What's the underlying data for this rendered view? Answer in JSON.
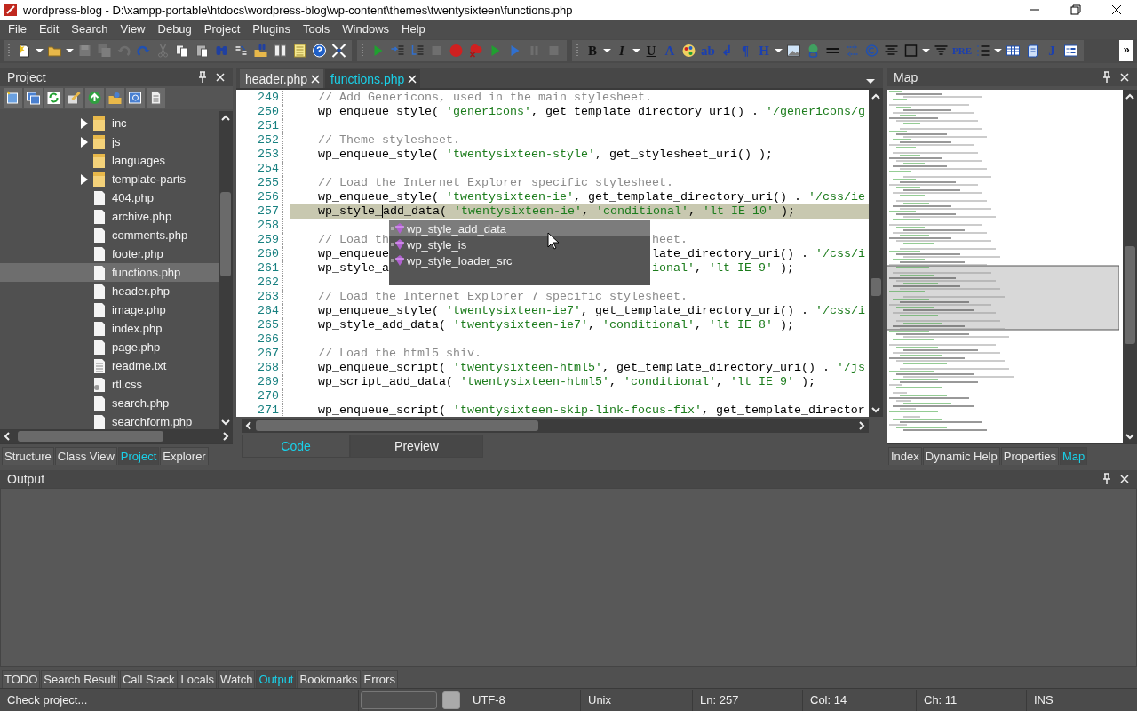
{
  "window": {
    "title": "wordpress-blog - D:\\xampp-portable\\htdocs\\wordpress-blog\\wp-content\\themes\\twentysixteen\\functions.php"
  },
  "menu": [
    "File",
    "Edit",
    "Search",
    "View",
    "Debug",
    "Project",
    "Plugins",
    "Tools",
    "Windows",
    "Help"
  ],
  "toolbars": [
    {
      "items": [
        {
          "kind": "new",
          "disabled": false
        },
        {
          "kind": "dropdown",
          "disabled": false
        },
        {
          "kind": "folder",
          "disabled": false
        },
        {
          "kind": "dropdown",
          "disabled": false
        },
        {
          "kind": "save",
          "disabled": true
        },
        {
          "kind": "saveall",
          "disabled": true
        },
        {
          "kind": "undo",
          "disabled": true
        },
        {
          "kind": "redo",
          "disabled": false
        },
        {
          "kind": "cut",
          "disabled": true
        },
        {
          "kind": "copy",
          "disabled": false
        },
        {
          "kind": "paste",
          "disabled": false
        },
        {
          "kind": "find",
          "disabled": false
        },
        {
          "kind": "replace",
          "disabled": false
        },
        {
          "kind": "findfiles",
          "disabled": false
        },
        {
          "kind": "columns",
          "disabled": false
        },
        {
          "kind": "list",
          "disabled": false
        },
        {
          "kind": "help",
          "disabled": false
        },
        {
          "kind": "fullscreen",
          "disabled": false
        }
      ]
    },
    {
      "items": [
        {
          "kind": "run",
          "disabled": false
        },
        {
          "kind": "stepinto",
          "disabled": false
        },
        {
          "kind": "stepout",
          "disabled": false
        },
        {
          "kind": "stop",
          "disabled": true
        },
        {
          "kind": "breakpoint",
          "disabled": false
        },
        {
          "kind": "clearbreak",
          "disabled": false
        },
        {
          "kind": "run",
          "disabled": false
        },
        {
          "kind": "runblue",
          "disabled": false
        },
        {
          "kind": "pause",
          "disabled": true
        },
        {
          "kind": "stop",
          "disabled": true
        }
      ]
    },
    {
      "items": [
        {
          "kind": "bold",
          "text": "B",
          "disabled": false
        },
        {
          "kind": "dropdown",
          "disabled": false
        },
        {
          "kind": "italic",
          "text": "I",
          "disabled": false
        },
        {
          "kind": "dropdown",
          "disabled": false
        },
        {
          "kind": "underline",
          "text": "U",
          "disabled": false
        },
        {
          "kind": "glyph",
          "text": "A",
          "disabled": false
        },
        {
          "kind": "palette",
          "disabled": false
        },
        {
          "kind": "glyph",
          "text": "ab",
          "disabled": false
        },
        {
          "kind": "glyph",
          "text": "↲",
          "disabled": false
        },
        {
          "kind": "glyph",
          "text": "¶",
          "disabled": false
        },
        {
          "kind": "glyph",
          "text": "H",
          "disabled": false
        },
        {
          "kind": "dropdown",
          "disabled": false
        },
        {
          "kind": "image",
          "disabled": false
        },
        {
          "kind": "globe",
          "disabled": false
        },
        {
          "kind": "hr",
          "disabled": false
        },
        {
          "kind": "arrows",
          "disabled": false
        },
        {
          "kind": "copyright",
          "disabled": false
        },
        {
          "kind": "center",
          "disabled": false
        },
        {
          "kind": "box",
          "disabled": false
        },
        {
          "kind": "dropdown",
          "disabled": false
        },
        {
          "kind": "align",
          "disabled": false
        },
        {
          "kind": "glyph",
          "text": "PRE",
          "disabled": false
        },
        {
          "kind": "numlist",
          "disabled": false
        },
        {
          "kind": "dropdown",
          "disabled": false
        },
        {
          "kind": "table",
          "disabled": false
        },
        {
          "kind": "script",
          "disabled": false
        },
        {
          "kind": "glyph",
          "text": "J",
          "disabled": false
        },
        {
          "kind": "form",
          "disabled": false
        }
      ]
    }
  ],
  "toolbar_overflow": "»",
  "project_panel": {
    "title": "Project",
    "tree": [
      {
        "name": "inc",
        "kind": "folder",
        "expandable": true,
        "selected": false
      },
      {
        "name": "js",
        "kind": "folder",
        "expandable": true,
        "selected": false
      },
      {
        "name": "languages",
        "kind": "folder",
        "expandable": false,
        "selected": false
      },
      {
        "name": "template-parts",
        "kind": "folder",
        "expandable": true,
        "selected": false
      },
      {
        "name": "404.php",
        "kind": "file",
        "expandable": false,
        "selected": false
      },
      {
        "name": "archive.php",
        "kind": "file",
        "expandable": false,
        "selected": false
      },
      {
        "name": "comments.php",
        "kind": "file",
        "expandable": false,
        "selected": false
      },
      {
        "name": "footer.php",
        "kind": "file",
        "expandable": false,
        "selected": false
      },
      {
        "name": "functions.php",
        "kind": "file",
        "expandable": false,
        "selected": true
      },
      {
        "name": "header.php",
        "kind": "file",
        "expandable": false,
        "selected": false
      },
      {
        "name": "image.php",
        "kind": "file",
        "expandable": false,
        "selected": false
      },
      {
        "name": "index.php",
        "kind": "file",
        "expandable": false,
        "selected": false
      },
      {
        "name": "page.php",
        "kind": "file",
        "expandable": false,
        "selected": false
      },
      {
        "name": "readme.txt",
        "kind": "text",
        "expandable": false,
        "selected": false
      },
      {
        "name": "rtl.css",
        "kind": "css",
        "expandable": false,
        "selected": false
      },
      {
        "name": "search.php",
        "kind": "file",
        "expandable": false,
        "selected": false
      },
      {
        "name": "searchform.php",
        "kind": "file",
        "expandable": false,
        "selected": false
      }
    ],
    "tabs": [
      {
        "label": "Structure",
        "selected": false
      },
      {
        "label": "Class View",
        "selected": false
      },
      {
        "label": "Project",
        "selected": true
      },
      {
        "label": "Explorer",
        "selected": false
      }
    ]
  },
  "editor": {
    "tabs": [
      {
        "label": "header.php",
        "selected": false
      },
      {
        "label": "functions.php",
        "selected": true
      }
    ],
    "lines": [
      {
        "number": "249",
        "current": false,
        "segments": [
          {
            "kind": "comment",
            "text": "// Add Genericons, used in the main stylesheet."
          }
        ]
      },
      {
        "number": "250",
        "current": false,
        "segments": [
          {
            "kind": "code",
            "text": "wp_enqueue_style( "
          },
          {
            "kind": "string",
            "text": "'genericons'"
          },
          {
            "kind": "code",
            "text": ", get_template_directory_uri() . "
          },
          {
            "kind": "string",
            "text": "'/genericons/g"
          }
        ]
      },
      {
        "number": "251",
        "current": false
      },
      {
        "number": "252",
        "current": false,
        "segments": [
          {
            "kind": "comment",
            "text": "// Theme stylesheet."
          }
        ]
      },
      {
        "number": "253",
        "current": false,
        "segments": [
          {
            "kind": "code",
            "text": "wp_enqueue_style( "
          },
          {
            "kind": "string",
            "text": "'twentysixteen-style'"
          },
          {
            "kind": "code",
            "text": ", get_stylesheet_uri() );"
          }
        ]
      },
      {
        "number": "254",
        "current": false
      },
      {
        "number": "255",
        "current": false,
        "segments": [
          {
            "kind": "comment",
            "text": "// Load the Internet Explorer specific stylesheet."
          }
        ]
      },
      {
        "number": "256",
        "current": false,
        "segments": [
          {
            "kind": "code",
            "text": "wp_enqueue_style( "
          },
          {
            "kind": "string",
            "text": "'twentysixteen-ie'"
          },
          {
            "kind": "code",
            "text": ", get_template_directory_uri() . "
          },
          {
            "kind": "string",
            "text": "'/css/ie"
          }
        ]
      },
      {
        "number": "257",
        "current": true,
        "segments": [
          {
            "kind": "code",
            "text": "wp_style_"
          },
          {
            "kind": "caret"
          },
          {
            "kind": "code",
            "text": "add_data( "
          },
          {
            "kind": "string",
            "text": "'twentysixteen-ie'"
          },
          {
            "kind": "code",
            "text": ", "
          },
          {
            "kind": "string",
            "text": "'conditional'"
          },
          {
            "kind": "code",
            "text": ", "
          },
          {
            "kind": "string",
            "text": "'lt IE 10'"
          },
          {
            "kind": "code",
            "text": " );"
          }
        ]
      },
      {
        "number": "258",
        "current": false
      },
      {
        "number": "259",
        "current": false,
        "segments": [
          {
            "kind": "comment",
            "text": "// Load th"
          }
        ],
        "after_popup": [
          {
            "kind": "comment",
            "text": "heet."
          }
        ]
      },
      {
        "number": "260",
        "current": false,
        "segments": [
          {
            "kind": "code",
            "text": "wp_enqueue"
          }
        ],
        "after_popup": [
          {
            "kind": "code",
            "text": "late_directory_uri() . "
          },
          {
            "kind": "string",
            "text": "'/css/i"
          }
        ]
      },
      {
        "number": "261",
        "current": false,
        "segments": [
          {
            "kind": "code",
            "text": "wp_style_a"
          }
        ],
        "after_popup": [
          {
            "kind": "string",
            "text": "ional'"
          },
          {
            "kind": "code",
            "text": ", "
          },
          {
            "kind": "string",
            "text": "'lt IE 9'"
          },
          {
            "kind": "code",
            "text": " );"
          }
        ]
      },
      {
        "number": "262",
        "current": false
      },
      {
        "number": "263",
        "current": false,
        "segments": [
          {
            "kind": "comment",
            "text": "// Load the Internet Explorer 7 specific stylesheet."
          }
        ]
      },
      {
        "number": "264",
        "current": false,
        "segments": [
          {
            "kind": "code",
            "text": "wp_enqueue_style( "
          },
          {
            "kind": "string",
            "text": "'twentysixteen-ie7'"
          },
          {
            "kind": "code",
            "text": ", get_template_directory_uri() . "
          },
          {
            "kind": "string",
            "text": "'/css/i"
          }
        ]
      },
      {
        "number": "265",
        "current": false,
        "segments": [
          {
            "kind": "code",
            "text": "wp_style_add_data( "
          },
          {
            "kind": "string",
            "text": "'twentysixteen-ie7'"
          },
          {
            "kind": "code",
            "text": ", "
          },
          {
            "kind": "string",
            "text": "'conditional'"
          },
          {
            "kind": "code",
            "text": ", "
          },
          {
            "kind": "string",
            "text": "'lt IE 8'"
          },
          {
            "kind": "code",
            "text": " );"
          }
        ]
      },
      {
        "number": "266",
        "current": false
      },
      {
        "number": "267",
        "current": false,
        "segments": [
          {
            "kind": "comment",
            "text": "// Load the html5 shiv."
          }
        ]
      },
      {
        "number": "268",
        "current": false,
        "segments": [
          {
            "kind": "code",
            "text": "wp_enqueue_script( "
          },
          {
            "kind": "string",
            "text": "'twentysixteen-html5'"
          },
          {
            "kind": "code",
            "text": ", get_template_directory_uri() . "
          },
          {
            "kind": "string",
            "text": "'/js"
          }
        ]
      },
      {
        "number": "269",
        "current": false,
        "segments": [
          {
            "kind": "code",
            "text": "wp_script_add_data( "
          },
          {
            "kind": "string",
            "text": "'twentysixteen-html5'"
          },
          {
            "kind": "code",
            "text": ", "
          },
          {
            "kind": "string",
            "text": "'conditional'"
          },
          {
            "kind": "code",
            "text": ", "
          },
          {
            "kind": "string",
            "text": "'lt IE 9'"
          },
          {
            "kind": "code",
            "text": " );"
          }
        ]
      },
      {
        "number": "270",
        "current": false
      },
      {
        "number": "271",
        "current": false,
        "segments": [
          {
            "kind": "code",
            "text": "wp_enqueue_script( "
          },
          {
            "kind": "string",
            "text": "'twentysixteen-skip-link-focus-fix'"
          },
          {
            "kind": "code",
            "text": ", get_template_director"
          }
        ]
      }
    ],
    "autocomplete": [
      {
        "label": "wp_style_add_data",
        "selected": true
      },
      {
        "label": "wp_style_is",
        "selected": false
      },
      {
        "label": "wp_style_loader_src",
        "selected": false
      }
    ],
    "view_tabs": [
      {
        "label": "Code",
        "selected": true
      },
      {
        "label": "Preview",
        "selected": false
      }
    ]
  },
  "map_panel": {
    "title": "Map",
    "tabs": [
      {
        "label": "Index",
        "selected": false
      },
      {
        "label": "Dynamic Help",
        "selected": false
      },
      {
        "label": "Properties",
        "selected": false
      },
      {
        "label": "Map",
        "selected": true
      }
    ]
  },
  "output_panel": {
    "title": "Output",
    "tabs": [
      {
        "label": "TODO",
        "selected": false
      },
      {
        "label": "Search Result",
        "selected": false
      },
      {
        "label": "Call Stack",
        "selected": false
      },
      {
        "label": "Locals",
        "selected": false
      },
      {
        "label": "Watch",
        "selected": false
      },
      {
        "label": "Output",
        "selected": true
      },
      {
        "label": "Bookmarks",
        "selected": false
      },
      {
        "label": "Errors",
        "selected": false
      }
    ]
  },
  "status_bar": {
    "message": "Check project...",
    "encoding": "UTF-8",
    "line_endings": "Unix",
    "line": "Ln: 257",
    "column": "Col: 14",
    "char": "Ch: 11",
    "mode": "INS"
  }
}
